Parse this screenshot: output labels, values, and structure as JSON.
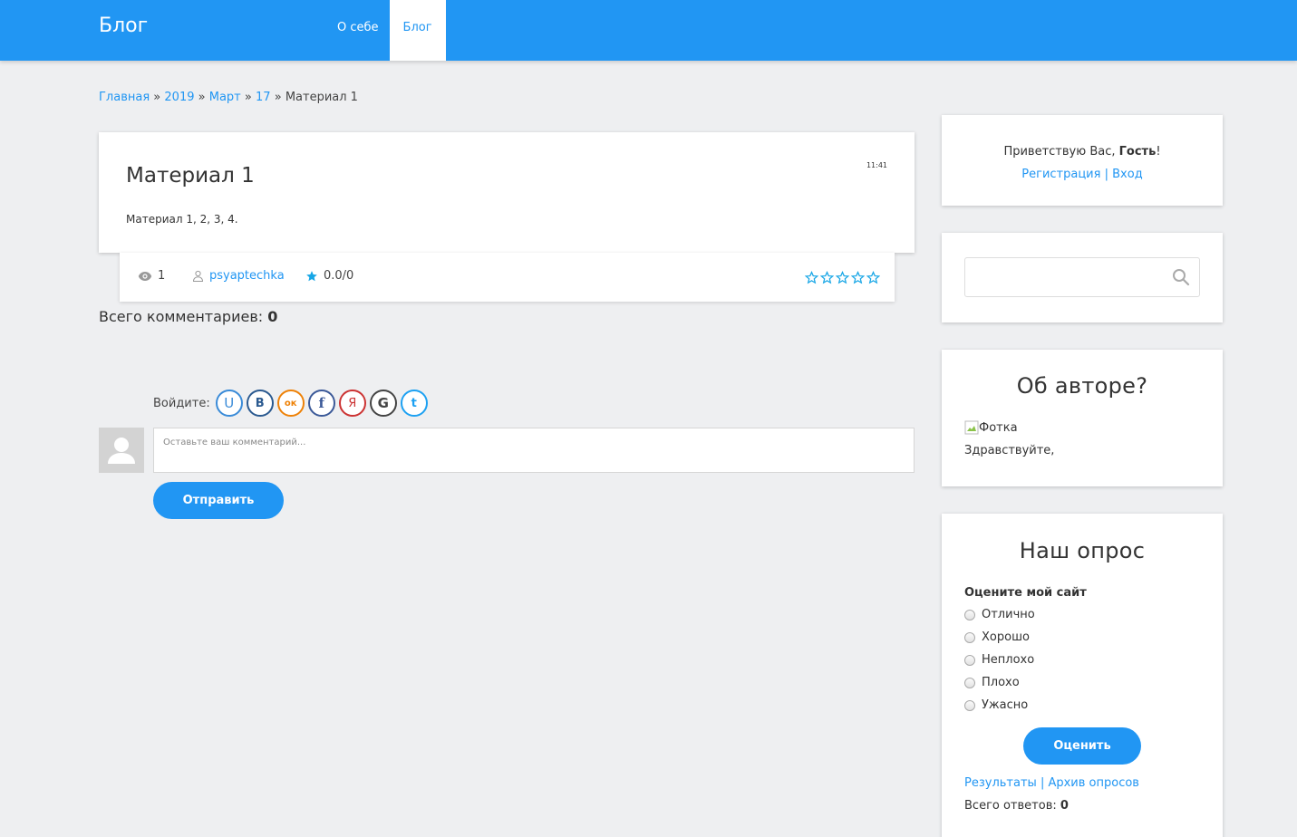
{
  "header": {
    "logo": "Блог",
    "nav": [
      "О себе",
      "Блог"
    ]
  },
  "breadcrumb": {
    "items": [
      "Главная",
      "2019",
      "Март",
      "17"
    ],
    "separator": "»",
    "current": "Материал 1"
  },
  "post": {
    "title": "Материал 1",
    "time": "11:41",
    "body": "Материал 1, 2, 3, 4.",
    "views": "1",
    "author": "psyaptechka",
    "rating": "0.0/0"
  },
  "comments": {
    "label": "Всего комментариев:",
    "count": "0",
    "login_label": "Войдите:",
    "placeholder": "Оставьте ваш комментарий...",
    "submit": "Отправить"
  },
  "social": [
    {
      "letter": "U",
      "color": "#3a8bd8"
    },
    {
      "letter": "В",
      "color": "#2b5a90"
    },
    {
      "letter": "ок",
      "color": "#ee8208"
    },
    {
      "letter": "f",
      "color": "#3b5998"
    },
    {
      "letter": "Я",
      "color": "#cc3333"
    },
    {
      "letter": "G",
      "color": "#444444"
    },
    {
      "letter": "t",
      "color": "#1da1f2"
    }
  ],
  "sidebar": {
    "greeting_prefix": "Приветствую Вас,",
    "greeting_name": "Гость",
    "greeting_suffix": "!",
    "register": "Регистрация",
    "login": "Вход",
    "about_title": "Об авторе?",
    "photo_alt": "Фотка",
    "about_text": "Здравствуйте,",
    "poll_title": "Наш опрос",
    "poll_question": "Оцените мой сайт",
    "poll_options": [
      "Отлично",
      "Хорошо",
      "Неплохо",
      "Плохо",
      "Ужасно"
    ],
    "vote_button": "Оценить",
    "results": "Результаты",
    "archive": "Архив опросов",
    "total_label": "Всего ответов:",
    "total_value": "0"
  },
  "colors": {
    "primary": "#2196f3",
    "star": "#17a6e6",
    "background": "#eeeff1"
  }
}
